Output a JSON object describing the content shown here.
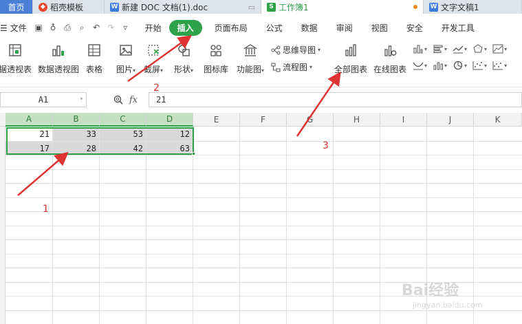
{
  "tabs": [
    {
      "label": "首页"
    },
    {
      "label": "稻壳模板"
    },
    {
      "label": "新建 DOC 文档(1).doc"
    },
    {
      "label": "工作簿1"
    },
    {
      "label": "文字文稿1"
    }
  ],
  "menu": {
    "file": "文件",
    "items": [
      "开始",
      "插入",
      "页面布局",
      "公式",
      "数据",
      "审阅",
      "视图",
      "安全",
      "开发工具"
    ],
    "active": "插入"
  },
  "ribbon": {
    "pivot_table": "据透视表",
    "pivot_chart": "数据透视图",
    "table": "表格",
    "picture": "图片",
    "screenshot": "截屏",
    "shape": "形状",
    "icon_lib": "图标库",
    "func_chart": "功能图",
    "mindmap": "思维导图",
    "flowchart": "流程图",
    "all_charts": "全部图表",
    "online_charts": "在线图表"
  },
  "formula": {
    "cell_ref": "A1",
    "fx_label": "fx",
    "value": "21"
  },
  "columns": [
    "A",
    "B",
    "C",
    "D",
    "E",
    "F",
    "G",
    "H",
    "I",
    "J",
    "K"
  ],
  "cells": [
    [
      "21",
      "33",
      "53",
      "12"
    ],
    [
      "17",
      "28",
      "42",
      "63"
    ]
  ],
  "annotations": {
    "n1": "1",
    "n2": "2",
    "n3": "3"
  },
  "watermark": {
    "brand": "Bai经验",
    "url": "jingyan.baidu.com"
  },
  "colors": {
    "accent_green": "#2ea24a",
    "annotation_red": "#dd3333",
    "home_tab_blue": "#4a7fd6"
  }
}
